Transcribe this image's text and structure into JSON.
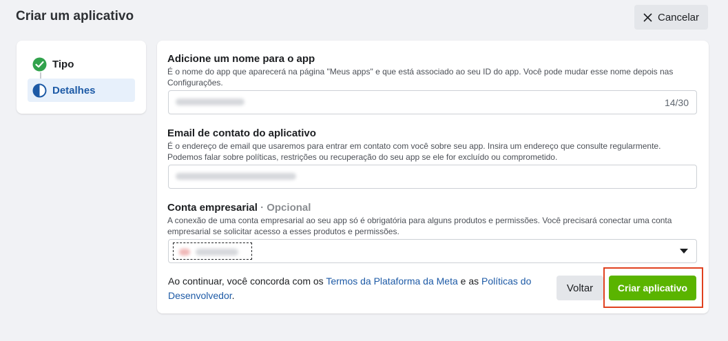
{
  "header": {
    "title": "Criar um aplicativo",
    "cancel_label": "Cancelar"
  },
  "steps": [
    {
      "label": "Tipo",
      "state": "complete"
    },
    {
      "label": "Detalhes",
      "state": "in-progress"
    }
  ],
  "form": {
    "app_name": {
      "label": "Adicione um nome para o app",
      "description": "É o nome do app que aparecerá na página \"Meus apps\" e que está associado ao seu ID do app. Você pode mudar esse nome depois nas Configurações.",
      "counter": "14/30"
    },
    "email": {
      "label": "Email de contato do aplicativo",
      "description": "É o endereço de email que usaremos para entrar em contato com você sobre seu app. Insira um endereço que consulte regularmente. Podemos falar sobre políticas, restrições ou recuperação do seu app se ele for excluído ou comprometido."
    },
    "business": {
      "label": "Conta empresarial",
      "optional": "· Opcional",
      "description": "A conexão de uma conta empresarial ao seu app só é obrigatória para alguns produtos e permissões. Você precisará conectar uma conta empresarial se solicitar acesso a esses produtos e permissões."
    },
    "consent": {
      "prefix": "Ao continuar, você concorda com os ",
      "link1": "Termos da Plataforma da Meta",
      "middle": " e as ",
      "link2": "Políticas do Desenvolvedor",
      "suffix": "."
    },
    "back_label": "Voltar",
    "create_label": "Criar aplicativo"
  },
  "colors": {
    "accent_green": "#5ab400",
    "link_blue": "#1d5aa6",
    "highlight_red": "#e0401e"
  }
}
